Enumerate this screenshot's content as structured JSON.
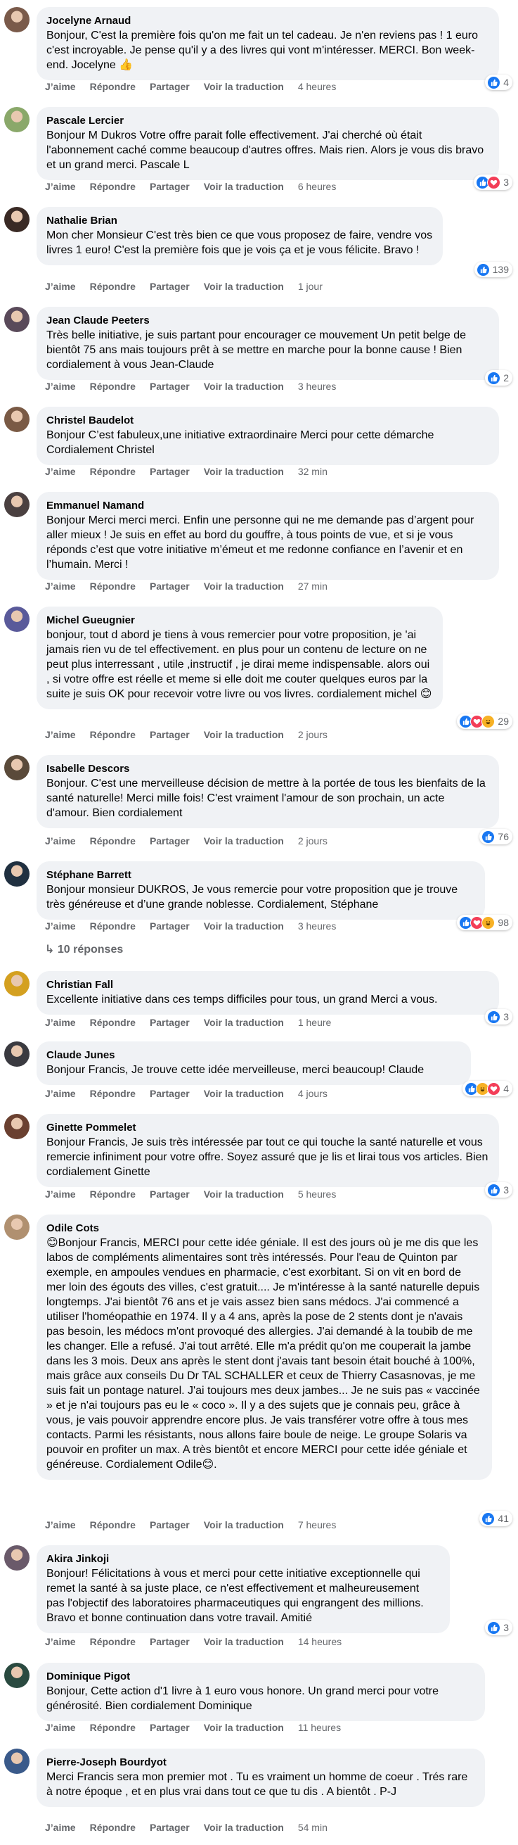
{
  "actions": {
    "like": "J’aime",
    "reply": "Répondre",
    "share": "Partager",
    "translate": "Voir la traduction"
  },
  "comments": [
    {
      "name": "Jocelyne Arnaud",
      "text": "Bonjour, C'est la première fois qu'on me fait un tel cadeau. Je n'en reviens pas ! 1 euro c'est incroyable. Je pense qu'il y a des livres qui vont m'intéresser. MERCI. Bon week-end. Jocelyne 👍",
      "time": "4 heures",
      "reaction_count": "4"
    },
    {
      "name": "Pascale Lercier",
      "text": "Bonjour M Dukros Votre offre parait folle effectivement. J'ai cherché où était l'abonnement caché comme beaucoup d'autres offres. Mais rien. Alors je vous dis bravo et un grand merci. Pascale L",
      "time": "6 heures",
      "reaction_count": "3"
    },
    {
      "name": "Nathalie Brian",
      "text": "Mon cher Monsieur C'est très bien ce que vous proposez de faire, vendre vos livres 1 euro! C'est la première fois que je vois ça et je vous félicite. Bravo !",
      "time": "1 jour",
      "reaction_count": "139"
    },
    {
      "name": "Jean Claude Peeters",
      "text": "Très belle initiative, je suis partant pour encourager ce mouvement Un petit belge de bientôt 75 ans mais toujours prêt à se mettre en marche pour la bonne cause ! Bien cordialement à vous Jean-Claude",
      "time": "3 heures",
      "reaction_count": "2"
    },
    {
      "name": "Christel Baudelot",
      "text": "Bonjour C’est fabuleux,une initiative extraordinaire Merci pour cette démarche Cordialement Christel",
      "time": "32 min",
      "reaction_count": ""
    },
    {
      "name": "Emmanuel Namand",
      "text": "Bonjour Merci merci merci. Enfin une personne qui ne me demande pas d’argent pour aller mieux ! Je suis en effet au bord du gouffre, à tous points de vue, et si je vous réponds c’est que votre initiative m’émeut et me redonne confiance en l’avenir et en l’humain. Merci !",
      "time": "27 min",
      "reaction_count": ""
    },
    {
      "name": "Michel Gueugnier",
      "text": "bonjour, tout d abord je tiens à vous remercier pour votre proposition, je 'ai jamais rien vu de tel effectivement. en plus pour un contenu de lecture on ne peut plus interressant , utile ,instructif , je dirai meme indispensable. alors oui , si votre offre est réelle et meme si elle doit me couter quelques euros par la suite je suis OK pour recevoir votre livre ou vos livres. cordialement michel 😊",
      "time": "2 jours",
      "reaction_count": "29"
    },
    {
      "name": "Isabelle Descors",
      "text": "Bonjour. C'est une merveilleuse décision de mettre à la portée de tous les bienfaits de la santé naturelle! Merci mille fois! C'est vraiment l'amour de son prochain, un acte d'amour. Bien cordialement",
      "time": "2 jours",
      "reaction_count": "76"
    },
    {
      "name": "Stéphane Barrett",
      "text": "Bonjour monsieur DUKROS, Je vous remercie pour votre proposition que je trouve très généreuse et d’une grande noblesse. Cordialement, Stéphane",
      "time": "3 heures",
      "reaction_count": "98",
      "replies": "10 réponses"
    },
    {
      "name": "Christian Fall",
      "text": "Excellente initiative dans ces temps difficiles pour tous, un grand Merci a vous.",
      "time": "1 heure",
      "reaction_count": "3"
    },
    {
      "name": "Claude Junes",
      "text": "Bonjour Francis, Je trouve cette idée merveilleuse, merci beaucoup! Claude",
      "time": "4 jours",
      "reaction_count": "4"
    },
    {
      "name": "Ginette Pommelet",
      "text": "Bonjour Francis, Je suis très intéressée par tout ce qui touche la santé naturelle et vous remercie infiniment pour votre offre. Soyez assuré que je lis et lirai tous vos articles. Bien cordialement Ginette",
      "time": "5 heures",
      "reaction_count": "3"
    },
    {
      "name": "Odile Cots",
      "text": "😊Bonjour Francis, MERCI pour cette idée géniale. Il est des jours où je me dis que les labos de compléments alimentaires sont très intéressés. Pour l'eau de Quinton par exemple, en ampoules vendues en pharmacie, c'est exorbitant. Si on vit en bord de mer loin des égouts des villes, c'est gratuit.... Je m'intéresse à la santé naturelle depuis longtemps. J'ai bientôt 76 ans et je vais assez bien sans médocs. J'ai commencé a utiliser l'homéopathie en 1974. Il y a 4 ans, après la pose de 2 stents dont je n'avais pas besoin, les médocs m'ont provoqué des allergies. J'ai demandé à la toubib de me les changer. Elle a refusé. J'ai tout arrêté. Elle m'a prédit qu'on me couperait la jambe dans les 3 mois. Deux ans après le stent dont j'avais tant besoin était bouché à 100%, mais grâce aux conseils Du Dr TAL SCHALLER et ceux de Thierry Casasnovas, je me suis fait un pontage naturel. J'ai toujours mes deux jambes... Je ne suis pas « vaccinée » et je n'ai toujours pas eu le « coco ». Il y a des sujets que je connais peu, grâce à vous, je vais pouvoir apprendre encore plus. Je vais transférer votre offre à tous mes contacts. Parmi les résistants, nous allons faire boule de neige. Le groupe Solaris va pouvoir en profiter un max. A très bientôt et encore MERCI pour cette idée géniale et généreuse. Cordialement Odile😊.",
      "time": "7 heures",
      "reaction_count": "41"
    },
    {
      "name": "Akira Jinkoji",
      "text": "Bonjour! Félicitations à vous et merci pour cette initiative exceptionnelle qui remet la santé à sa juste place, ce n'est effectivement et malheureusement pas l'objectif des laboratoires pharmaceutiques qui engrangent des millions. Bravo et bonne continuation dans votre travail. Amitié",
      "time": "14 heures",
      "reaction_count": "3"
    },
    {
      "name": "Dominique Pigot",
      "text": "Bonjour, Cette action d'1 livre à 1 euro vous honore. Un grand merci pour votre générosité. Bien cordialement Dominique",
      "time": "11 heures",
      "reaction_count": ""
    },
    {
      "name": "Pierre-Joseph Bourdyot",
      "text": "Merci Francis sera mon premier mot . Tu es vraiment un homme de coeur . Trés rare à notre époque , et en plus vrai dans tout ce que tu dis . A bientôt . P-J",
      "time": "54 min",
      "reaction_count": ""
    }
  ],
  "colors": {
    "bubble": "#f0f2f5",
    "meta": "#65676b",
    "like": "#1877f2",
    "love": "#f33e58",
    "haha": "#f7b125"
  }
}
